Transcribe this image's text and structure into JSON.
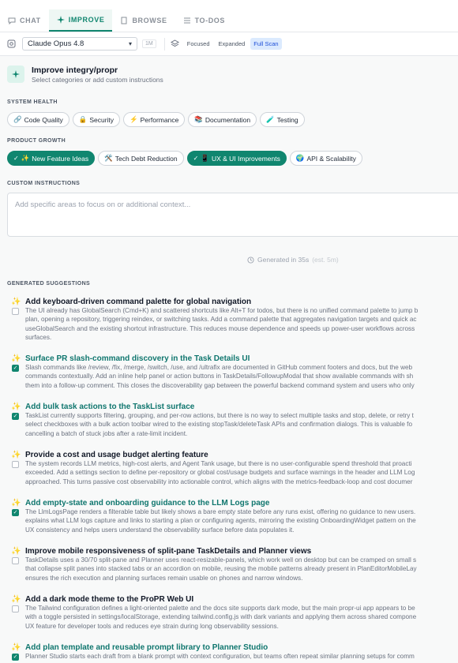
{
  "tabs": [
    {
      "label": "CHAT",
      "icon": "chat-icon"
    },
    {
      "label": "IMPROVE",
      "icon": "sparkle-icon"
    },
    {
      "label": "BROWSE",
      "icon": "document-icon"
    },
    {
      "label": "TO-DOS",
      "icon": "list-icon"
    }
  ],
  "active_tab": "IMPROVE",
  "model": {
    "selected": "Claude Opus 4.8",
    "context": "1M"
  },
  "scan_modes": [
    "Focused",
    "Expanded",
    "Full Scan"
  ],
  "active_scan_mode": "Full Scan",
  "header": {
    "title": "Improve integry/propr",
    "subtitle": "Select categories or add custom instructions"
  },
  "system_health": {
    "label": "SYSTEM HEALTH",
    "chips": [
      {
        "icon": "🔗",
        "label": "Code Quality",
        "selected": false
      },
      {
        "icon": "🔒",
        "label": "Security",
        "selected": false
      },
      {
        "icon": "⚡",
        "label": "Performance",
        "selected": false
      },
      {
        "icon": "📚",
        "label": "Documentation",
        "selected": false
      },
      {
        "icon": "🧪",
        "label": "Testing",
        "selected": false
      }
    ]
  },
  "product_growth": {
    "label": "PRODUCT GROWTH",
    "chips": [
      {
        "icon": "✨",
        "label": "New Feature Ideas",
        "selected": true
      },
      {
        "icon": "🛠️",
        "label": "Tech Debt Reduction",
        "selected": false
      },
      {
        "icon": "📱",
        "label": "UX & UI Improvements",
        "selected": true
      },
      {
        "icon": "🌍",
        "label": "API & Scalability",
        "selected": false
      }
    ]
  },
  "custom_instructions": {
    "label": "CUSTOM INSTRUCTIONS",
    "placeholder": "Add specific areas to focus on or additional context..."
  },
  "generated": {
    "text": "Generated in 35s",
    "estimate": "(est. 5m)"
  },
  "suggestions_label": "GENERATED SUGGESTIONS",
  "suggestions": [
    {
      "title": "Add keyboard-driven command palette for global navigation",
      "selected": false,
      "lines": [
        "The UI already has GlobalSearch (Cmd+K) and scattered shortcuts like Alt+T for todos, but there is no unified command palette to jump b",
        "plan, opening a repository, triggering reindex, or switching tasks. Add a command palette that aggregates navigation targets and quick ac",
        "useGlobalSearch and the existing shortcut infrastructure. This reduces mouse dependence and speeds up power-user workflows across",
        "surfaces."
      ]
    },
    {
      "title": "Surface PR slash-command discovery in the Task Details UI",
      "selected": true,
      "lines": [
        "Slash commands like /review, /fix, /merge, /switch, /use, and /ultrafix are documented in GitHub comment footers and docs, but the web",
        "commands contextually. Add an inline help panel or action buttons in TaskDetails/FollowupModal that show available commands with sh",
        "them into a follow-up comment. This closes the discoverability gap between the powerful backend command system and users who only"
      ]
    },
    {
      "title": "Add bulk task actions to the TaskList surface",
      "selected": true,
      "lines": [
        "TaskList currently supports filtering, grouping, and per-row actions, but there is no way to select multiple tasks and stop, delete, or retry t",
        "select checkboxes with a bulk action toolbar wired to the existing stopTask/deleteTask APIs and confirmation dialogs. This is valuable fo",
        "cancelling a batch of stuck jobs after a rate-limit incident."
      ]
    },
    {
      "title": "Provide a cost and usage budget alerting feature",
      "selected": false,
      "lines": [
        "The system records LLM metrics, high-cost alerts, and Agent Tank usage, but there is no user-configurable spend threshold that proacti",
        "exceeded. Add a settings section to define per-repository or global cost/usage budgets and surface warnings in the header and LLM Log",
        "approached. This turns passive cost observability into actionable control, which aligns with the metrics-feedback-loop and cost documer"
      ]
    },
    {
      "title": "Add empty-state and onboarding guidance to the LLM Logs page",
      "selected": true,
      "lines": [
        "The LlmLogsPage renders a filterable table but likely shows a bare empty state before any runs exist, offering no guidance to new users.",
        "explains what LLM logs capture and links to starting a plan or configuring agents, mirroring the existing OnboardingWidget pattern on the",
        "UX consistency and helps users understand the observability surface before data populates it."
      ]
    },
    {
      "title": "Improve mobile responsiveness of split-pane TaskDetails and Planner views",
      "selected": false,
      "lines": [
        "TaskDetails uses a 30/70 split-pane and Planner uses react-resizable-panels, which work well on desktop but can be cramped on small s",
        "that collapse split panes into stacked tabs or an accordion on mobile, reusing the mobile patterns already present in PlanEditorMobileLay",
        "ensures the rich execution and planning surfaces remain usable on phones and narrow windows."
      ]
    },
    {
      "title": "Add a dark mode theme to the ProPR Web UI",
      "selected": false,
      "lines": [
        "The Tailwind configuration defines a light-oriented palette and the docs site supports dark mode, but the main propr-ui app appears to be",
        "with a toggle persisted in settings/localStorage, extending tailwind.config.js with dark variants and applying them across shared compone",
        "UX feature for developer tools and reduces eye strain during long observability sessions."
      ]
    },
    {
      "title": "Add plan template and reusable prompt library to Planner Studio",
      "selected": true,
      "lines": [
        "Planner Studio starts each draft from a blank prompt with context configuration, but teams often repeat similar planning setups for comm"
      ]
    }
  ]
}
